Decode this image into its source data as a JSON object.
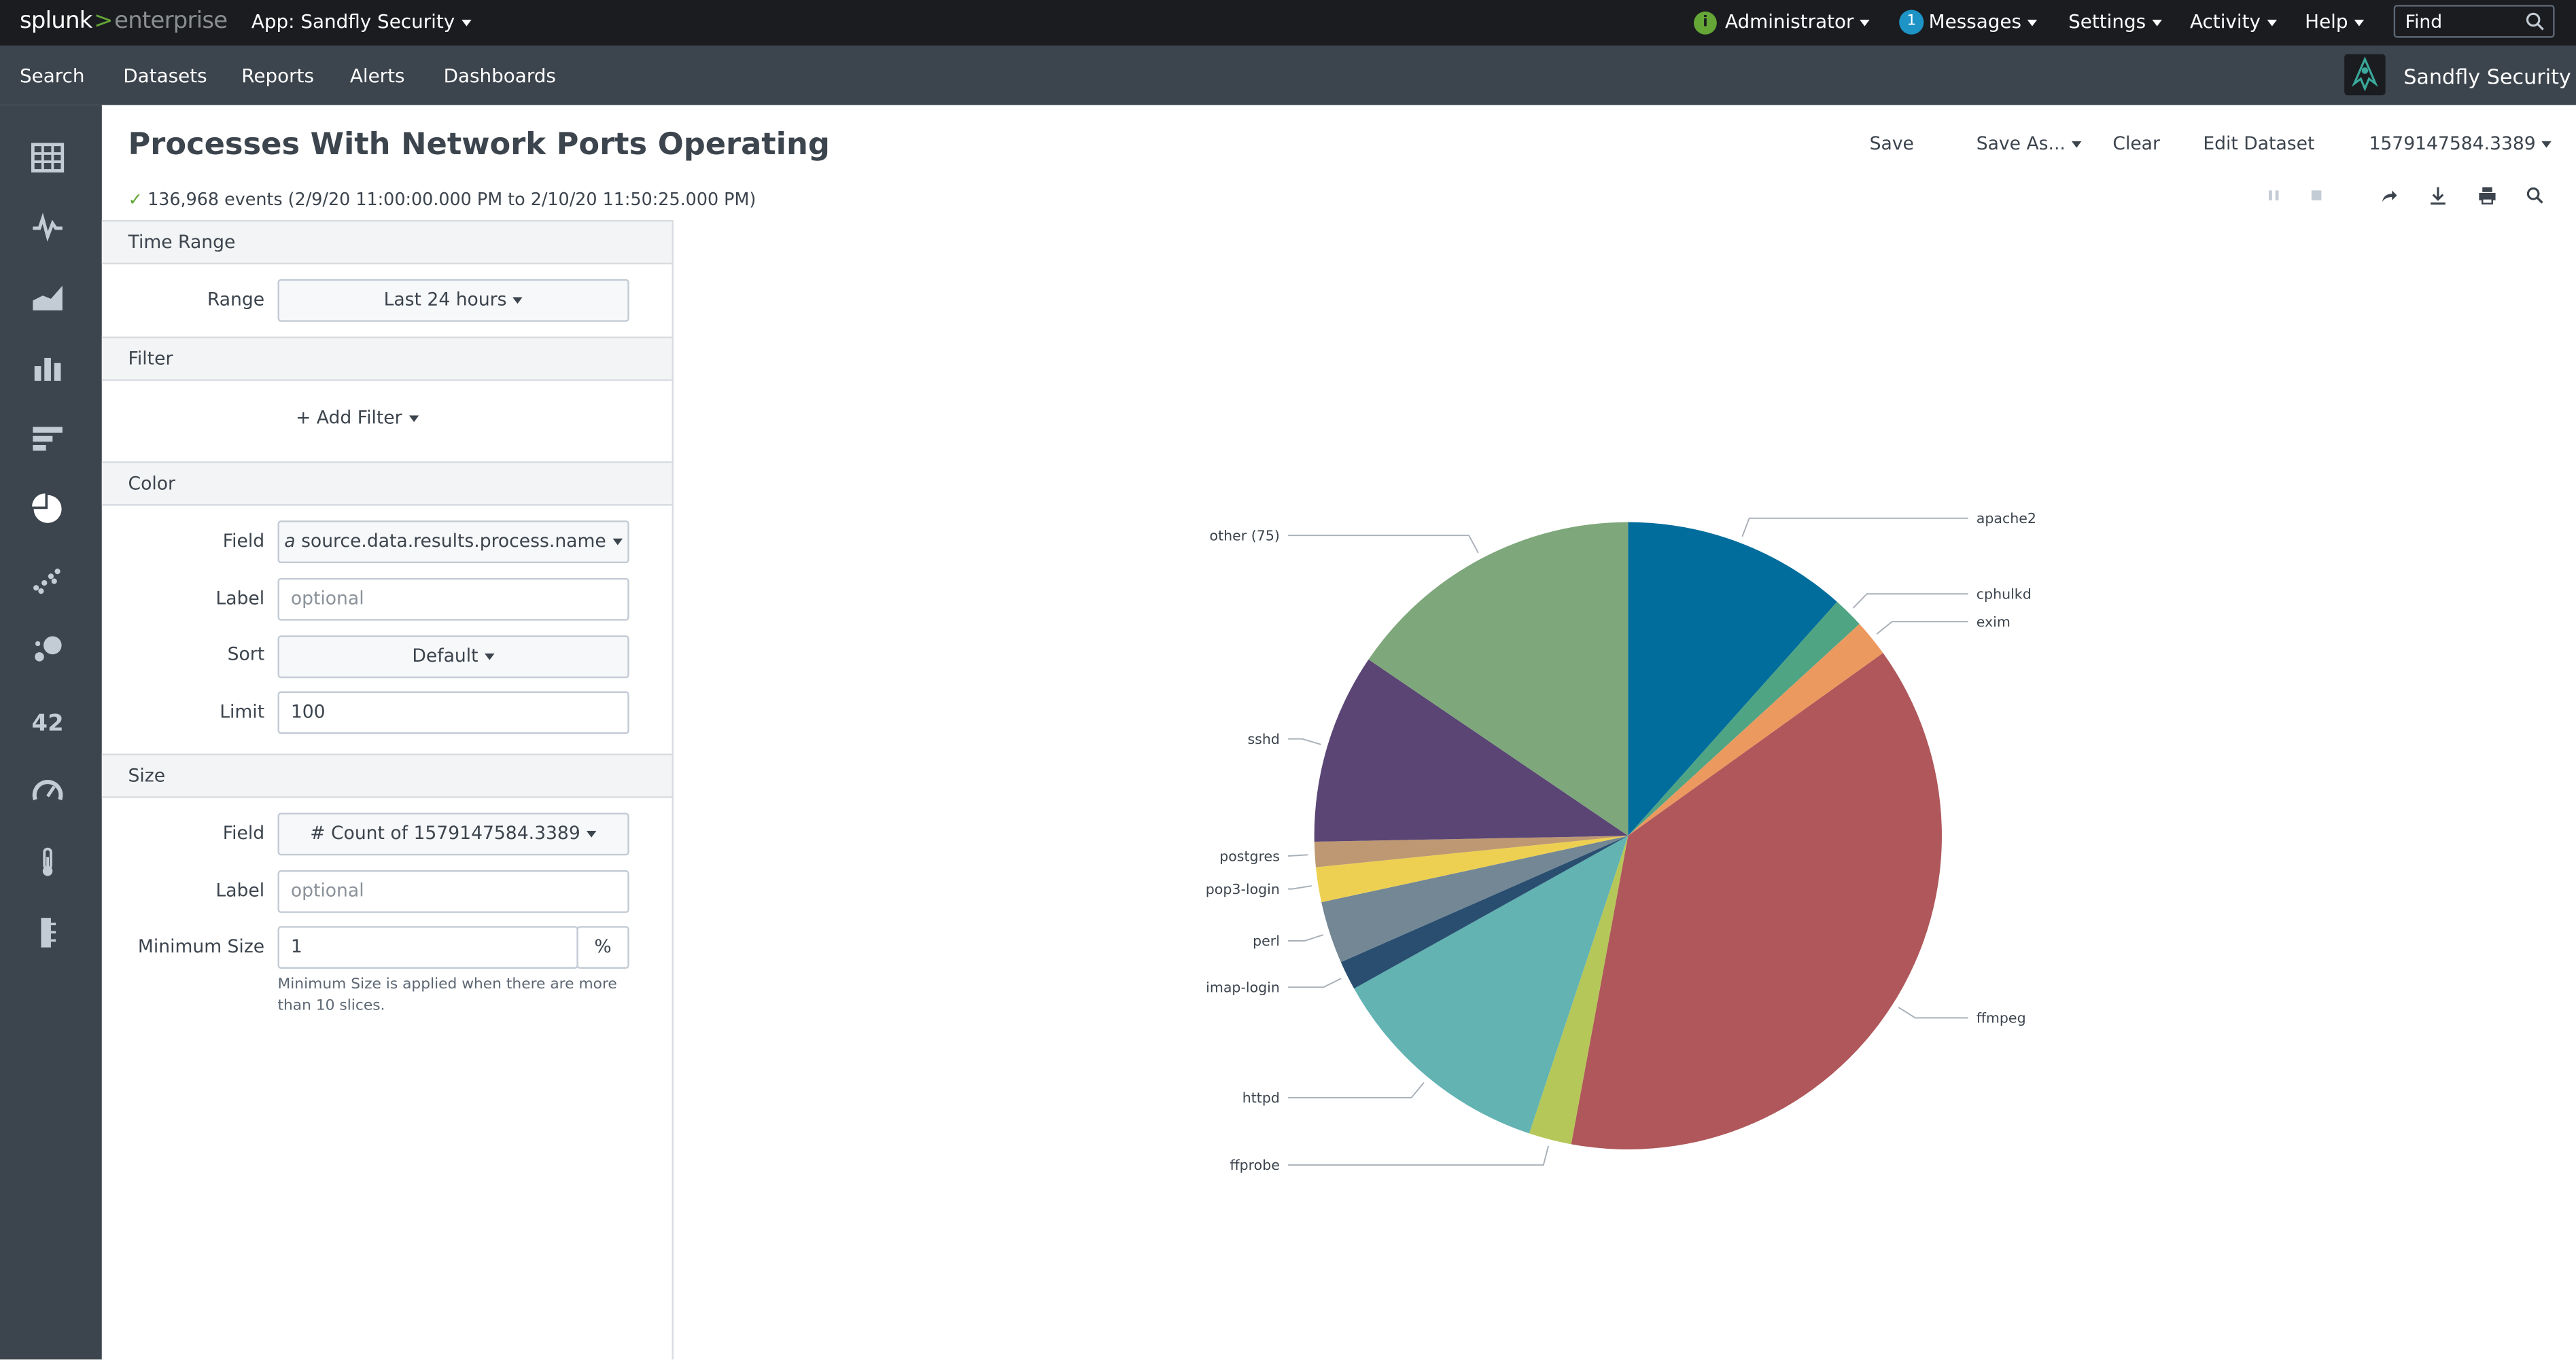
{
  "topbar": {
    "logo_main": "splunk",
    "logo_sep": ">",
    "logo_suffix": "enterprise",
    "app_menu": "App: Sandfly Security",
    "admin": "Administrator",
    "messages_count": "1",
    "messages": "Messages",
    "settings": "Settings",
    "activity": "Activity",
    "help": "Help",
    "find_placeholder": "Find"
  },
  "navbar": {
    "items": [
      "Search",
      "Datasets",
      "Reports",
      "Alerts",
      "Dashboards"
    ],
    "app_name": "Sandfly Security"
  },
  "header": {
    "title": "Processes With Network Ports Operating",
    "events": "136,968 events (2/9/20 11:00:00.000 PM to 2/10/20 11:50:25.000 PM)",
    "save": "Save",
    "save_as": "Save As...",
    "clear": "Clear",
    "edit_dataset": "Edit Dataset",
    "dataset_id": "1579147584.3389"
  },
  "panel": {
    "time_range": {
      "heading": "Time Range",
      "range_label": "Range",
      "range_value": "Last 24 hours"
    },
    "filter": {
      "heading": "Filter",
      "add_filter": "+ Add Filter"
    },
    "color": {
      "heading": "Color",
      "field_label": "Field",
      "field_type": "a",
      "field_value": "source.data.results.process.name",
      "label_label": "Label",
      "label_placeholder": "optional",
      "sort_label": "Sort",
      "sort_value": "Default",
      "limit_label": "Limit",
      "limit_value": "100"
    },
    "size": {
      "heading": "Size",
      "field_label": "Field",
      "field_value": "# Count of 1579147584.3389",
      "label_label": "Label",
      "label_placeholder": "optional",
      "min_size_label": "Minimum Size",
      "min_size_value": "1",
      "min_size_unit": "%",
      "help": "Minimum Size is applied when there are more than 10 slices."
    }
  },
  "chart_data": {
    "type": "pie",
    "categories": [
      "apache2",
      "cphulkd",
      "exim",
      "ffmpeg",
      "ffprobe",
      "httpd",
      "imap-login",
      "perl",
      "pop3-login",
      "postgres",
      "sshd",
      "other (75)"
    ],
    "values": [
      11.6,
      1.6,
      1.9,
      37.8,
      2.2,
      11.8,
      1.5,
      3.2,
      1.8,
      1.3,
      9.8,
      15.5
    ],
    "colors": [
      "#006d9c",
      "#4fa484",
      "#ec9960",
      "#af575a",
      "#b6c75a",
      "#62b3b2",
      "#294e70",
      "#738795",
      "#edd051",
      "#bd9872",
      "#5a4575",
      "#7ea77b"
    ]
  }
}
